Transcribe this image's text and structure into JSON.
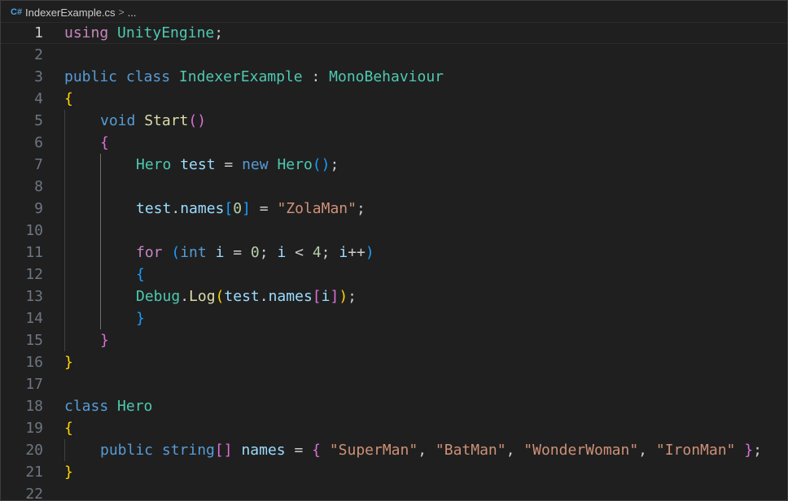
{
  "breadcrumb": {
    "file_icon": "csharp-file-icon",
    "file_name": "IndexerExample.cs",
    "chevron": ">",
    "ellipsis": "..."
  },
  "editor": {
    "current_line": 1,
    "lines": [
      {
        "n": "1",
        "indent": 0,
        "tokens": [
          [
            "ctrl",
            "using"
          ],
          [
            "p",
            " "
          ],
          [
            "type",
            "UnityEngine"
          ],
          [
            "p",
            ";"
          ]
        ]
      },
      {
        "n": "2",
        "indent": 0,
        "tokens": []
      },
      {
        "n": "3",
        "indent": 0,
        "tokens": [
          [
            "kw",
            "public"
          ],
          [
            "p",
            " "
          ],
          [
            "kw",
            "class"
          ],
          [
            "p",
            " "
          ],
          [
            "type",
            "IndexerExample"
          ],
          [
            "p",
            " : "
          ],
          [
            "type",
            "MonoBehaviour"
          ]
        ]
      },
      {
        "n": "4",
        "indent": 0,
        "tokens": [
          [
            "b1",
            "{"
          ]
        ]
      },
      {
        "n": "5",
        "indent": 1,
        "tokens": [
          [
            "kw",
            "void"
          ],
          [
            "p",
            " "
          ],
          [
            "fn",
            "Start"
          ],
          [
            "b2",
            "()"
          ]
        ]
      },
      {
        "n": "6",
        "indent": 1,
        "tokens": [
          [
            "b2",
            "{"
          ]
        ]
      },
      {
        "n": "7",
        "indent": 2,
        "tokens": [
          [
            "type",
            "Hero"
          ],
          [
            "p",
            " "
          ],
          [
            "var",
            "test"
          ],
          [
            "p",
            " = "
          ],
          [
            "kw",
            "new"
          ],
          [
            "p",
            " "
          ],
          [
            "type",
            "Hero"
          ],
          [
            "b3",
            "()"
          ],
          [
            "p",
            ";"
          ]
        ]
      },
      {
        "n": "8",
        "indent": 0,
        "tokens": []
      },
      {
        "n": "9",
        "indent": 2,
        "tokens": [
          [
            "var",
            "test"
          ],
          [
            "p",
            "."
          ],
          [
            "var",
            "names"
          ],
          [
            "b3",
            "["
          ],
          [
            "num",
            "0"
          ],
          [
            "b3",
            "]"
          ],
          [
            "p",
            " = "
          ],
          [
            "str",
            "\"ZolaMan\""
          ],
          [
            "p",
            ";"
          ]
        ]
      },
      {
        "n": "10",
        "indent": 0,
        "tokens": []
      },
      {
        "n": "11",
        "indent": 2,
        "tokens": [
          [
            "ctrl",
            "for"
          ],
          [
            "p",
            " "
          ],
          [
            "b3",
            "("
          ],
          [
            "kw",
            "int"
          ],
          [
            "p",
            " "
          ],
          [
            "var",
            "i"
          ],
          [
            "p",
            " = "
          ],
          [
            "num",
            "0"
          ],
          [
            "p",
            "; "
          ],
          [
            "var",
            "i"
          ],
          [
            "p",
            " < "
          ],
          [
            "num",
            "4"
          ],
          [
            "p",
            "; "
          ],
          [
            "var",
            "i"
          ],
          [
            "p",
            "++"
          ],
          [
            "b3",
            ")"
          ]
        ]
      },
      {
        "n": "12",
        "indent": 2,
        "tokens": [
          [
            "b3",
            "{"
          ]
        ]
      },
      {
        "n": "13",
        "indent": 2,
        "tokens": [
          [
            "type",
            "Debug"
          ],
          [
            "p",
            "."
          ],
          [
            "fn",
            "Log"
          ],
          [
            "b1",
            "("
          ],
          [
            "var",
            "test"
          ],
          [
            "p",
            "."
          ],
          [
            "var",
            "names"
          ],
          [
            "b2",
            "["
          ],
          [
            "var",
            "i"
          ],
          [
            "b2",
            "]"
          ],
          [
            "b1",
            ")"
          ],
          [
            "p",
            ";"
          ]
        ]
      },
      {
        "n": "14",
        "indent": 2,
        "tokens": [
          [
            "b3",
            "}"
          ]
        ]
      },
      {
        "n": "15",
        "indent": 1,
        "tokens": [
          [
            "b2",
            "}"
          ]
        ]
      },
      {
        "n": "16",
        "indent": 0,
        "tokens": [
          [
            "b1",
            "}"
          ]
        ]
      },
      {
        "n": "17",
        "indent": 0,
        "tokens": []
      },
      {
        "n": "18",
        "indent": 0,
        "tokens": [
          [
            "kw",
            "class"
          ],
          [
            "p",
            " "
          ],
          [
            "type",
            "Hero"
          ]
        ]
      },
      {
        "n": "19",
        "indent": 0,
        "tokens": [
          [
            "b1",
            "{"
          ]
        ]
      },
      {
        "n": "20",
        "indent": 1,
        "tokens": [
          [
            "kw",
            "public"
          ],
          [
            "p",
            " "
          ],
          [
            "kw",
            "string"
          ],
          [
            "b2",
            "[]"
          ],
          [
            "p",
            " "
          ],
          [
            "var",
            "names"
          ],
          [
            "p",
            " = "
          ],
          [
            "b2",
            "{"
          ],
          [
            "p",
            " "
          ],
          [
            "str",
            "\"SuperMan\""
          ],
          [
            "p",
            ", "
          ],
          [
            "str",
            "\"BatMan\""
          ],
          [
            "p",
            ", "
          ],
          [
            "str",
            "\"WonderWoman\""
          ],
          [
            "p",
            ", "
          ],
          [
            "str",
            "\"IronMan\""
          ],
          [
            "p",
            " "
          ],
          [
            "b2",
            "}"
          ],
          [
            "p",
            ";"
          ]
        ]
      },
      {
        "n": "21",
        "indent": 0,
        "tokens": [
          [
            "b1",
            "}"
          ]
        ]
      },
      {
        "n": "22",
        "indent": 0,
        "tokens": []
      }
    ]
  }
}
